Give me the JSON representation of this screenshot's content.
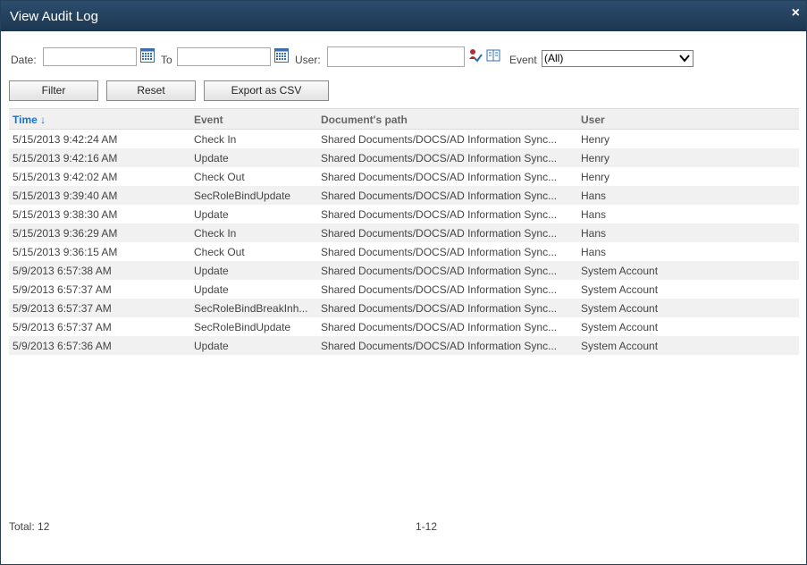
{
  "window": {
    "title": "View Audit Log",
    "close_glyph": "×"
  },
  "filters": {
    "date_label": "Date:",
    "date_from_value": "",
    "to_label": "To",
    "date_to_value": "",
    "user_label": "User:",
    "user_value": "",
    "event_label": "Event",
    "event_selected": "(All)"
  },
  "buttons": {
    "filter": "Filter",
    "reset": "Reset",
    "export": "Export as CSV"
  },
  "table": {
    "headers": {
      "time": "Time ↓",
      "event": "Event",
      "path": "Document's path",
      "user": "User"
    },
    "rows": [
      {
        "time": "5/15/2013 9:42:24 AM",
        "event": "Check In",
        "path": "Shared Documents/DOCS/AD Information Sync...",
        "user": "Henry"
      },
      {
        "time": "5/15/2013 9:42:16 AM",
        "event": "Update",
        "path": "Shared Documents/DOCS/AD Information Sync...",
        "user": "Henry"
      },
      {
        "time": "5/15/2013 9:42:02 AM",
        "event": "Check Out",
        "path": "Shared Documents/DOCS/AD Information Sync...",
        "user": "Henry"
      },
      {
        "time": "5/15/2013 9:39:40 AM",
        "event": "SecRoleBindUpdate",
        "path": "Shared Documents/DOCS/AD Information Sync...",
        "user": "Hans"
      },
      {
        "time": "5/15/2013 9:38:30 AM",
        "event": "Update",
        "path": "Shared Documents/DOCS/AD Information Sync...",
        "user": "Hans"
      },
      {
        "time": "5/15/2013 9:36:29 AM",
        "event": "Check In",
        "path": "Shared Documents/DOCS/AD Information Sync...",
        "user": "Hans"
      },
      {
        "time": "5/15/2013 9:36:15 AM",
        "event": "Check Out",
        "path": "Shared Documents/DOCS/AD Information Sync...",
        "user": "Hans"
      },
      {
        "time": "5/9/2013 6:57:38 AM",
        "event": "Update",
        "path": "Shared Documents/DOCS/AD Information Sync...",
        "user": "System Account"
      },
      {
        "time": "5/9/2013 6:57:37 AM",
        "event": "Update",
        "path": "Shared Documents/DOCS/AD Information Sync...",
        "user": "System Account"
      },
      {
        "time": "5/9/2013 6:57:37 AM",
        "event": "SecRoleBindBreakInh...",
        "path": "Shared Documents/DOCS/AD Information Sync...",
        "user": "System Account"
      },
      {
        "time": "5/9/2013 6:57:37 AM",
        "event": "SecRoleBindUpdate",
        "path": "Shared Documents/DOCS/AD Information Sync...",
        "user": "System Account"
      },
      {
        "time": "5/9/2013 6:57:36 AM",
        "event": "Update",
        "path": "Shared Documents/DOCS/AD Information Sync...",
        "user": "System Account"
      }
    ]
  },
  "footer": {
    "total": "Total: 12",
    "range": "1-12"
  },
  "icons": [
    "calendar-icon",
    "check-names-icon",
    "address-book-icon",
    "close-icon",
    "dropdown-arrow-icon"
  ],
  "colors": {
    "titlebar": "#1f3a55",
    "accent": "#1a72c9",
    "alt_row": "#f1f1f1"
  }
}
